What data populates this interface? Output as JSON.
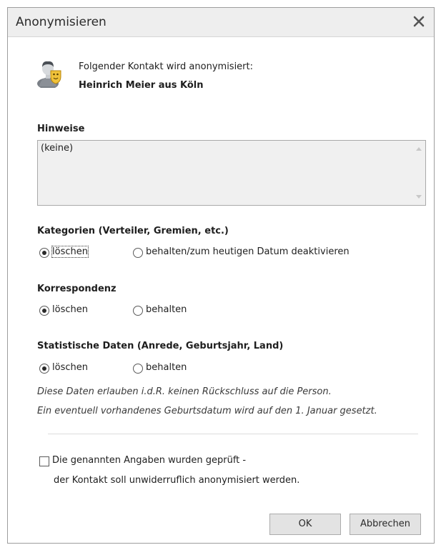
{
  "window": {
    "title": "Anonymisieren"
  },
  "header": {
    "intro": "Folgender Kontakt wird anonymisiert:",
    "contact_name": "Heinrich Meier aus Köln"
  },
  "notes": {
    "label": "Hinweise",
    "value": "(keine)"
  },
  "categories": {
    "label": "Kategorien (Verteiler, Gremien, etc.)",
    "option_delete": "löschen",
    "option_keep": "behalten/zum heutigen Datum deaktivieren",
    "selected": "löschen"
  },
  "correspondence": {
    "label": "Korrespondenz",
    "option_delete": "löschen",
    "option_keep": "behalten",
    "selected": "löschen"
  },
  "statistics": {
    "label": "Statistische Daten (Anrede, Geburtsjahr, Land)",
    "option_delete": "löschen",
    "option_keep": "behalten",
    "selected": "löschen",
    "hint_line1": "Diese Daten erlauben i.d.R. keinen Rückschluss auf die Person.",
    "hint_line2": "Ein eventuell vorhandenes Geburtsdatum wird auf den 1. Januar gesetzt."
  },
  "confirm": {
    "line1": "Die genannten Angaben wurden geprüft -",
    "line2": "der Kontakt soll unwiderruflich anonymisiert werden.",
    "checked": false
  },
  "buttons": {
    "ok": "OK",
    "cancel": "Abbrechen"
  },
  "icons": {
    "close": "close-icon",
    "contact": "contact-anonymous-icon"
  }
}
